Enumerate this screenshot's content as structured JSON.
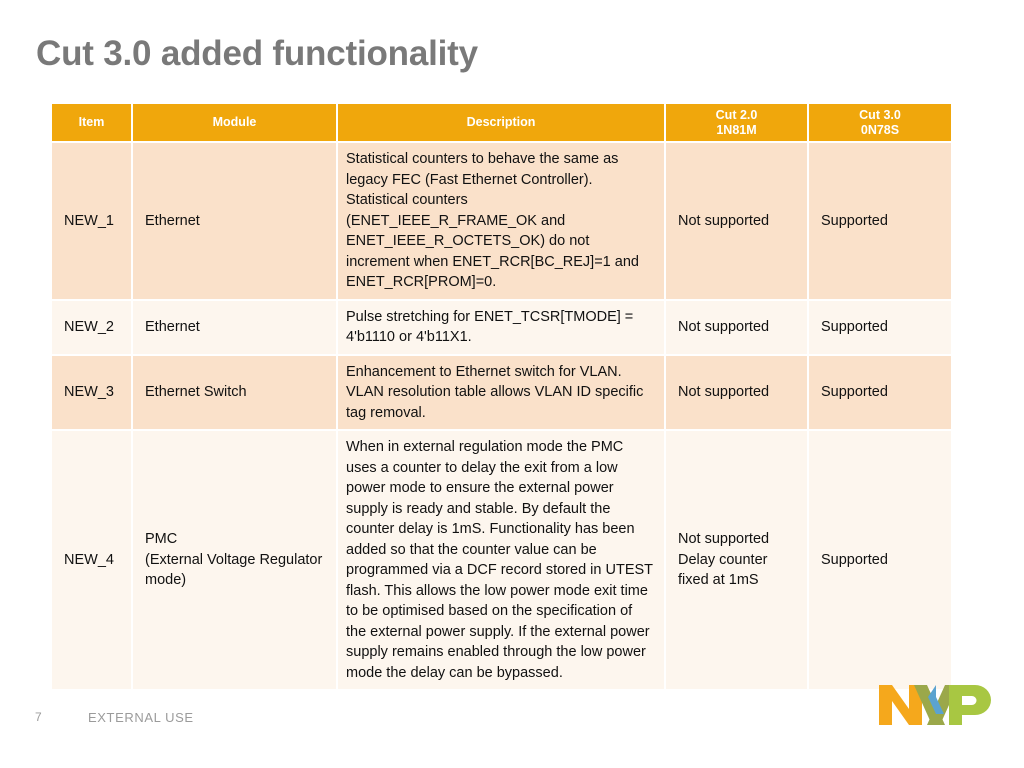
{
  "slide": {
    "title": "Cut 3.0 added functionality",
    "page_number": "7",
    "confidentiality": "EXTERNAL USE"
  },
  "colors": {
    "header_orange": "#F0A70C",
    "row_shade_dark": "#FAE1CA",
    "row_shade_light": "#FDF6EE",
    "title_gray": "#797979",
    "footer_gray": "#9b9b9b",
    "logo_orange": "#F5A81C",
    "logo_blue": "#5BA3D0",
    "logo_green": "#A8C742",
    "logo_dark_green": "#7A9B2E",
    "logo_dark_orange": "#C8941B"
  },
  "table": {
    "headers": [
      {
        "label": "Item",
        "sub": ""
      },
      {
        "label": "Module",
        "sub": ""
      },
      {
        "label": "Description",
        "sub": ""
      },
      {
        "label": "Cut 2.0",
        "sub": "1N81M"
      },
      {
        "label": "Cut 3.0",
        "sub": "0N78S"
      }
    ],
    "rows": [
      {
        "item": "NEW_1",
        "module": "Ethernet",
        "description": "Statistical counters to behave the same as legacy FEC (Fast Ethernet Controller). Statistical counters (ENET_IEEE_R_FRAME_OK and ENET_IEEE_R_OCTETS_OK) do not increment when ENET_RCR[BC_REJ]=1 and ENET_RCR[PROM]=0.",
        "cut20": "Not supported",
        "cut30": "Supported",
        "shade": "a"
      },
      {
        "item": "NEW_2",
        "module": "Ethernet",
        "description": "Pulse stretching for ENET_TCSR[TMODE] = 4'b1110 or 4'b11X1.",
        "cut20": "Not supported",
        "cut30": "Supported",
        "shade": "b"
      },
      {
        "item": "NEW_3",
        "module": "Ethernet Switch",
        "description": "Enhancement to Ethernet switch for VLAN. VLAN resolution table allows VLAN ID specific tag removal.",
        "cut20": "Not supported",
        "cut30": "Supported",
        "shade": "a"
      },
      {
        "item": "NEW_4",
        "module": "PMC\n(External Voltage Regulator mode)",
        "description": "When in external regulation mode the PMC uses a counter to delay the exit from a low power mode to ensure the external power supply is ready and stable.   By default the counter delay is 1mS.  Functionality has been added so that the counter value can be programmed via a DCF record stored in UTEST flash. This allows the low power mode exit time to be optimised based on the specification of the external power supply.  If the external power supply remains enabled through the low power mode the delay can be bypassed.",
        "cut20": "Not supported\nDelay counter fixed at 1mS",
        "cut30": "Supported",
        "shade": "b"
      }
    ]
  }
}
